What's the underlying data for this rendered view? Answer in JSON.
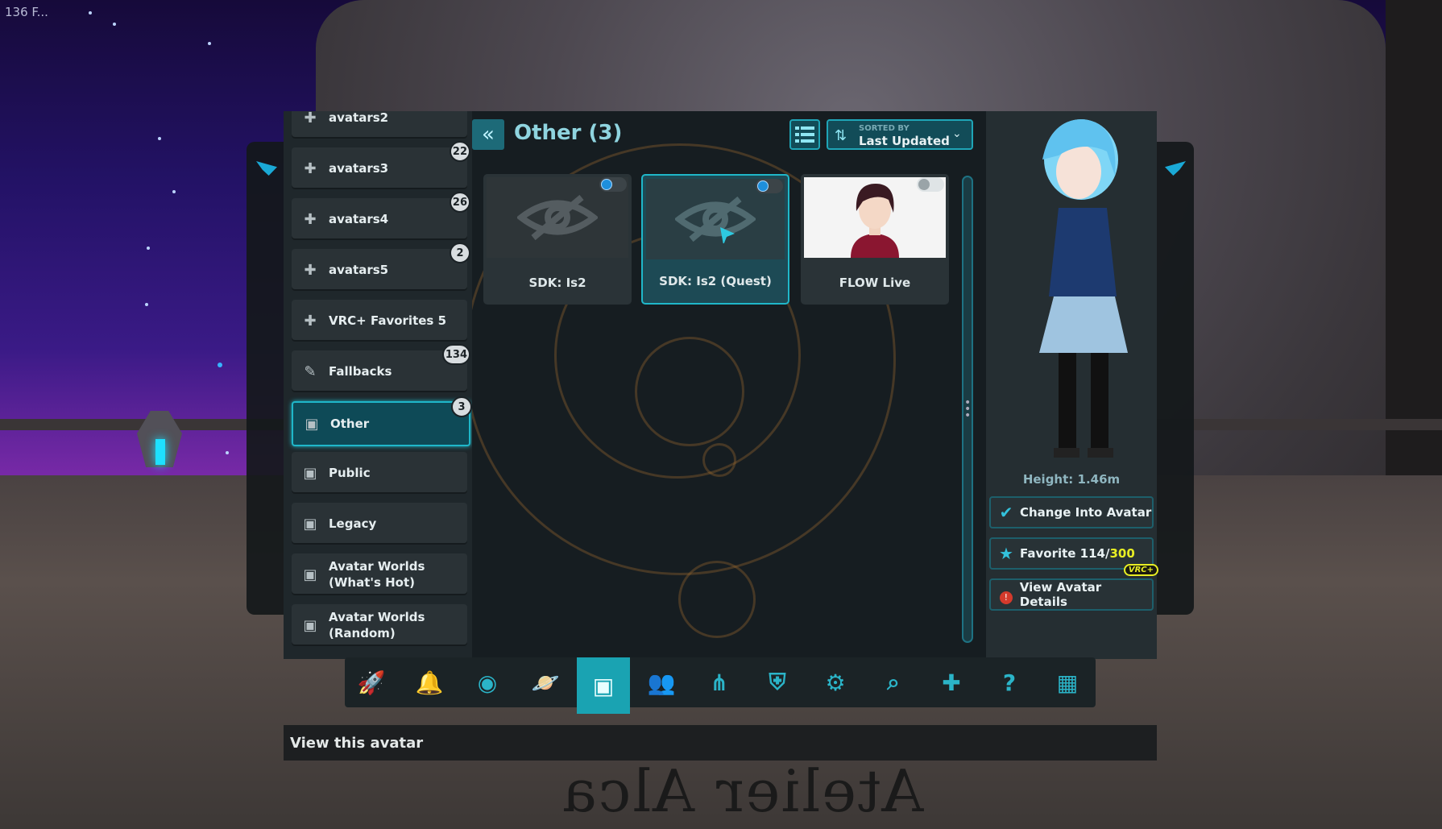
{
  "overlay": {
    "fps_text": "136 F..."
  },
  "sidebar": {
    "items": [
      {
        "label": "avatars2",
        "badge": "",
        "icon": "chat-plus-icon"
      },
      {
        "label": "avatars3",
        "badge": "22",
        "icon": "chat-plus-icon"
      },
      {
        "label": "avatars4",
        "badge": "26",
        "icon": "chat-plus-icon"
      },
      {
        "label": "avatars5",
        "badge": "2",
        "icon": "chat-plus-icon"
      },
      {
        "label": "VRC+ Favorites 5",
        "badge": "",
        "icon": "chat-plus-icon"
      },
      {
        "label": "Fallbacks",
        "badge": "134",
        "icon": "feather-icon"
      },
      {
        "label": "Other",
        "badge": "3",
        "icon": "avatar-card-icon"
      },
      {
        "label": "Public",
        "badge": "",
        "icon": "avatar-card-icon"
      },
      {
        "label": "Legacy",
        "badge": "",
        "icon": "avatar-card-icon"
      },
      {
        "label": "Avatar Worlds",
        "label2": "(What's Hot)",
        "badge": "",
        "icon": "avatar-card-icon"
      },
      {
        "label": "Avatar Worlds",
        "label2": "(Random)",
        "badge": "",
        "icon": "avatar-card-icon"
      }
    ]
  },
  "content": {
    "title": "Other (3)",
    "sort": {
      "caption": "SORTED BY",
      "value": "Last Updated"
    },
    "cards": [
      {
        "label": "SDK: Is2"
      },
      {
        "label": "SDK: Is2 (Quest)"
      },
      {
        "label": "FLOW Live"
      }
    ]
  },
  "details": {
    "height": "Height: 1.46m",
    "change_label": "Change Into Avatar",
    "favorite_label": "Favorite 114/",
    "favorite_max": "300",
    "vrc_plus": "VRC+",
    "view_details_label": "View Avatar Details"
  },
  "nav": [
    "rocket-icon",
    "bell-icon",
    "profile-icon",
    "planet-icon",
    "avatars-icon",
    "social-icon",
    "groups-icon",
    "safety-shield-icon",
    "settings-gear-icon",
    "search-icon",
    "chat-add-icon",
    "help-icon",
    "gallery-icon"
  ],
  "tooltip": "View this avatar",
  "logo_text": "Atelier Alca",
  "colors": {
    "accent": "#1fb7c9",
    "active_nav": "#1aa3b2",
    "vrc_plus": "#e8ee24"
  }
}
